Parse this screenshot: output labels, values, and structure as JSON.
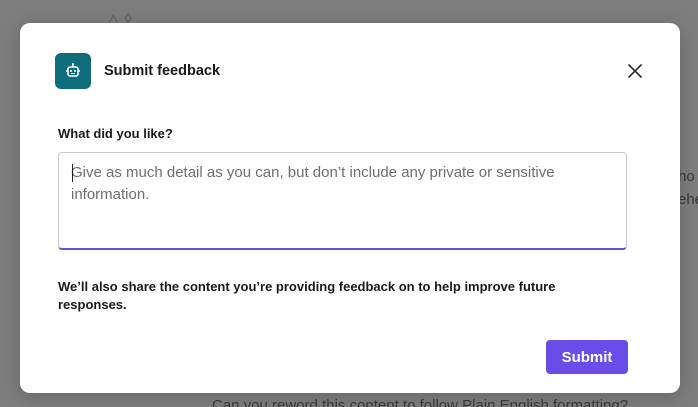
{
  "dialog": {
    "title": "Submit feedback",
    "field_label": "What did you like?",
    "textarea": {
      "value": "",
      "placeholder": "Give as much detail as you can, but don’t include any private or sensitive information."
    },
    "notice": "We’ll also share the content you’re providing feedback on to help improve future responses.",
    "submit_label": "Submit"
  },
  "background": {
    "fragment_1": "ho",
    "fragment_2": "ehe",
    "fragment_3": "Can you reword this content to follow Plain English formatting?"
  },
  "icons": {
    "app": "robot-icon",
    "close": "close-icon"
  },
  "colors": {
    "app_icon_bg": "#0f6d7b",
    "accent": "#6a4de8",
    "overlay": "#7b7b7b"
  }
}
